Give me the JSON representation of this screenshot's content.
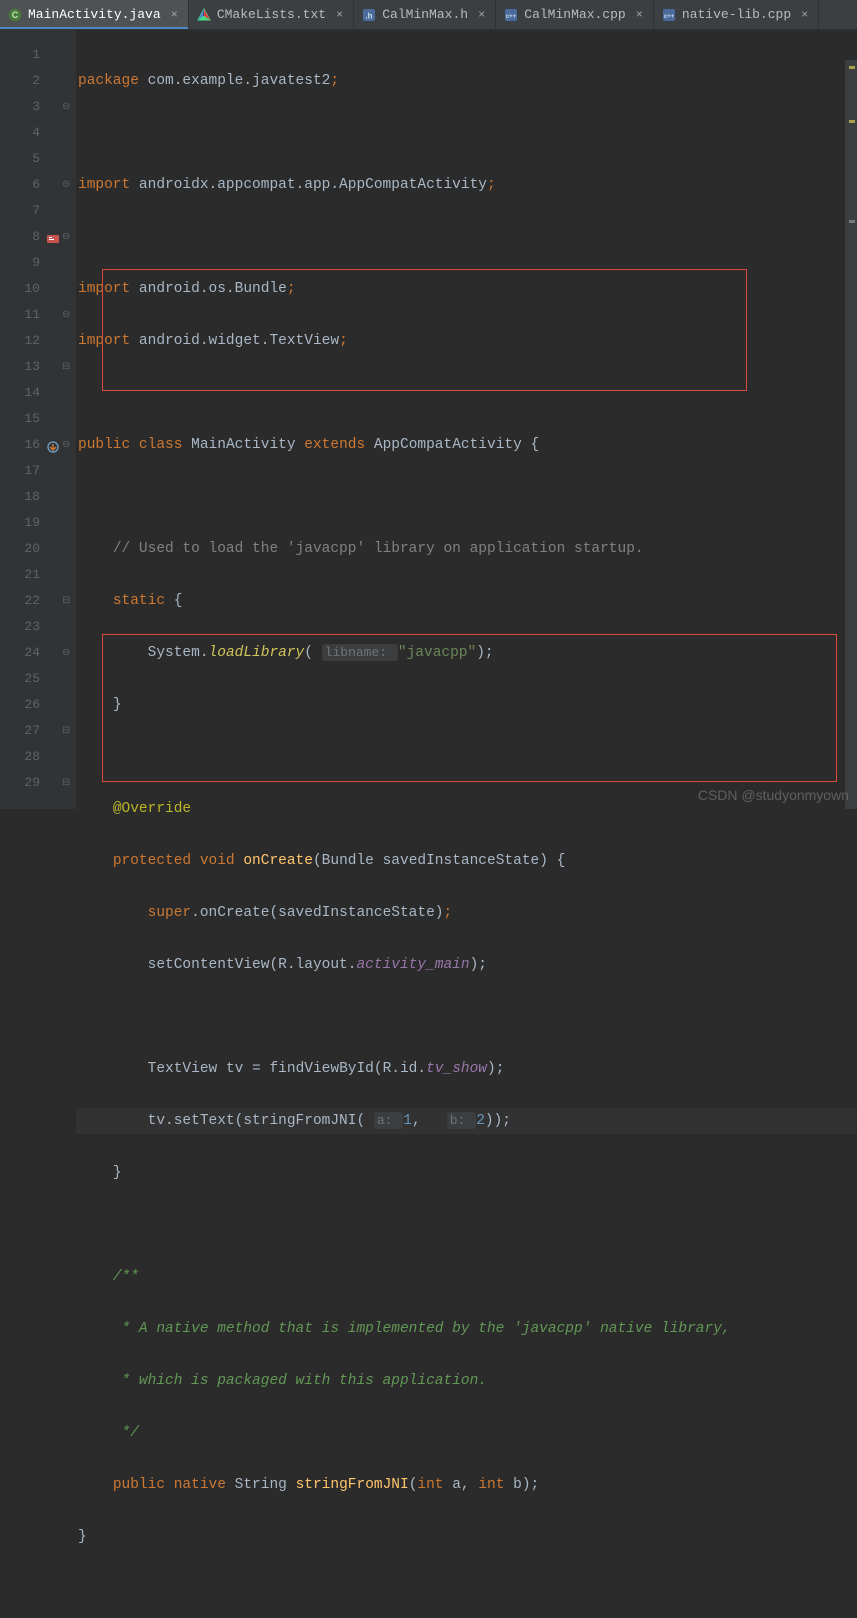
{
  "tabs": [
    {
      "label": "MainActivity.java",
      "active": true,
      "icon": "class"
    },
    {
      "label": "CMakeLists.txt",
      "active": false,
      "icon": "cmake"
    },
    {
      "label": "CalMinMax.h",
      "active": false,
      "icon": "h"
    },
    {
      "label": "CalMinMax.cpp",
      "active": false,
      "icon": "cpp"
    },
    {
      "label": "native-lib.cpp",
      "active": false,
      "icon": "cpp"
    }
  ],
  "code": {
    "l1": {
      "kw1": "package ",
      "pkg": "com.example.javatest2",
      "semi": ";"
    },
    "l3": {
      "kw": "import ",
      "pkg": "androidx.appcompat.app.AppCompatActivity",
      "semi": ";"
    },
    "l5": {
      "kw": "import ",
      "pkg": "android.os.Bundle",
      "semi": ";"
    },
    "l6": {
      "kw": "import ",
      "pkg": "android.widget.TextView",
      "semi": ";"
    },
    "l8": {
      "pub": "public ",
      "cls": "class ",
      "name": "MainActivity ",
      "ext": "extends ",
      "sup": "AppCompatActivity ",
      "brace": "{"
    },
    "l10": {
      "c": "// Used to load the 'javacpp' library on application startup."
    },
    "l11": {
      "kw": "static ",
      "brace": "{"
    },
    "l12": {
      "sys": "System.",
      "m": "loadLibrary",
      "open": "( ",
      "hint": "libname: ",
      "str": "\"javacpp\"",
      "close": ");"
    },
    "l13": {
      "brace": "}"
    },
    "l15": {
      "ann": "@Override"
    },
    "l16": {
      "prot": "protected ",
      "void": "void ",
      "name": "onCreate",
      "open": "(",
      "ptype": "Bundle ",
      "pname": "savedInstanceState",
      "close": ") {"
    },
    "l17": {
      "super": "super",
      "dot": ".onCreate(savedInstanceState)",
      "semi": ";"
    },
    "l18": {
      "m": "setContentView(R.layout.",
      "f": "activity_main",
      "close": ");"
    },
    "l20": {
      "type": "TextView ",
      "var": "tv = findViewById(R.id.",
      "f": "tv_show",
      "close": ");"
    },
    "l21": {
      "var": "tv.setText(stringFromJNI( ",
      "h1": "a: ",
      "n1": "1",
      "comma": ",   ",
      "h2": "b: ",
      "n2": "2",
      "close": "));"
    },
    "l22": {
      "brace": "}"
    },
    "l24": {
      "d": "/**"
    },
    "l25": {
      "d": " * A native method that is implemented by the 'javacpp' native library,"
    },
    "l26": {
      "d": " * which is packaged with this application."
    },
    "l27": {
      "d": " */"
    },
    "l28": {
      "pub": "public ",
      "nat": "native ",
      "ret": "String ",
      "name": "stringFromJNI",
      "open": "(",
      "p1": "int ",
      "pn1": "a",
      ", ": "",
      " ": "",
      "p2": "int ",
      "pn2": "b",
      "close": ");"
    },
    "comma": ", ",
    "l29": {
      "brace": "}"
    }
  },
  "watermark": "CSDN @studyonmyown",
  "line_count": 29,
  "highlighted_line": 21
}
